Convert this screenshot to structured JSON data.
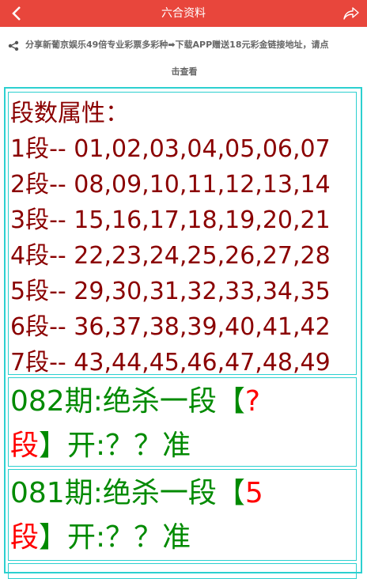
{
  "header": {
    "title": "六合资料",
    "back_icon": "chevron-left-icon",
    "share_icon": "share-forward-icon",
    "bg_color": "#e8463c"
  },
  "notice": {
    "icon": "share-nodes-icon",
    "text_line1": "分享新葡京娱乐49倍专业彩票多彩种➡下载APP赠送18元彩金链接地址，请点",
    "text_line2": "击查看"
  },
  "segments": {
    "heading": "段数属性：",
    "rows": [
      "1段-- 01,02,03,04,05,06,07",
      "2段-- 08,09,10,11,12,13,14",
      "3段-- 15,16,17,18,19,20,21",
      "4段-- 22,23,24,25,26,27,28",
      "5段-- 29,30,31,32,33,34,35",
      "6段-- 36,37,38,39,40,41,42",
      "7段-- 43,44,45,46,47,48,49"
    ]
  },
  "predictions": [
    {
      "prefix": "082期:绝杀一段【",
      "value": "?",
      "value2": "段",
      "suffix": "】开:？？准"
    },
    {
      "prefix": "081期:绝杀一段【",
      "value": "5",
      "value2": "段",
      "suffix": "】开:？？准"
    }
  ],
  "colors": {
    "frame": "#2cd0d0",
    "segment_text": "#8a0000",
    "prediction_text": "#008a00",
    "highlight": "#ff0000"
  }
}
